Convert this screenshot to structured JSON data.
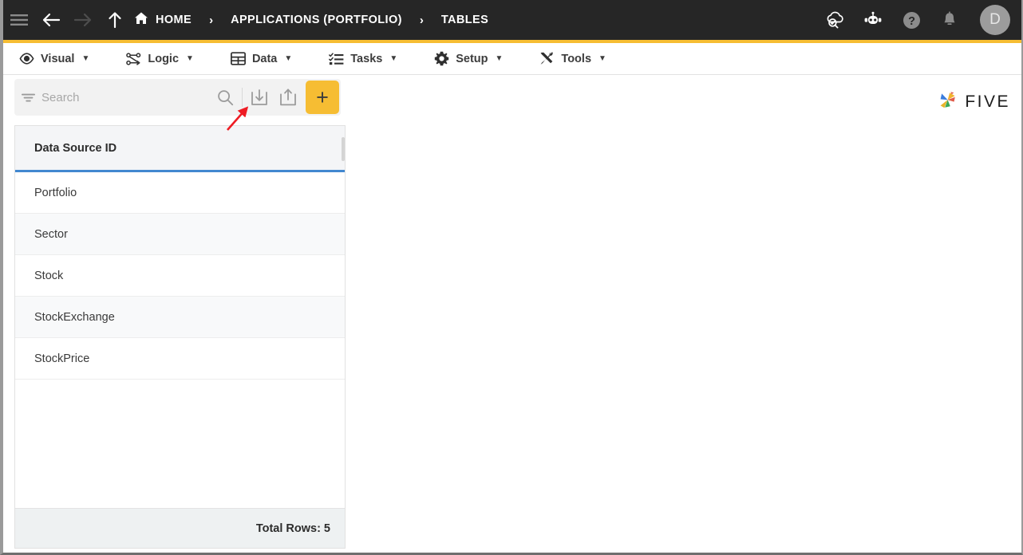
{
  "header": {
    "menu_icon": "hamburger-icon",
    "nav": [
      {
        "name": "back",
        "icon": "arrow-left-icon",
        "enabled": true
      },
      {
        "name": "forward",
        "icon": "arrow-right-icon",
        "enabled": false
      },
      {
        "name": "up",
        "icon": "arrow-up-icon",
        "enabled": true
      }
    ],
    "breadcrumbs": [
      {
        "label": "HOME",
        "icon": "home-icon"
      },
      {
        "label": "APPLICATIONS (PORTFOLIO)",
        "icon": ""
      },
      {
        "label": "TABLES",
        "icon": ""
      }
    ],
    "separator": "›",
    "actions": [
      {
        "name": "cloud-check-icon",
        "label": ""
      },
      {
        "name": "robot-icon",
        "label": ""
      },
      {
        "name": "help-icon",
        "label": ""
      },
      {
        "name": "bell-icon",
        "label": ""
      }
    ],
    "avatar_initial": "D",
    "accent_color": "#f6bd33",
    "bar_color": "#262626"
  },
  "menubar": {
    "items": [
      {
        "label": "Visual",
        "icon": "eye-icon",
        "caret": "▼"
      },
      {
        "label": "Logic",
        "icon": "logic-nodes-icon",
        "caret": "▼"
      },
      {
        "label": "Data",
        "icon": "grid-icon",
        "caret": "▼"
      },
      {
        "label": "Tasks",
        "icon": "checklist-icon",
        "caret": "▼"
      },
      {
        "label": "Setup",
        "icon": "gear-icon",
        "caret": "▼"
      },
      {
        "label": "Tools",
        "icon": "tools-icon",
        "caret": "▼"
      }
    ],
    "brand": "FIVE"
  },
  "toolbar": {
    "filter_icon": "filter-icon",
    "search_placeholder": "Search",
    "search_value": "",
    "search_icon": "search-icon",
    "import_icon": "import-icon",
    "export_icon": "export-icon",
    "add_label": "+"
  },
  "table": {
    "columns": [
      "Data Source ID"
    ],
    "rows": [
      {
        "data_source_id": "Portfolio"
      },
      {
        "data_source_id": "Sector"
      },
      {
        "data_source_id": "Stock"
      },
      {
        "data_source_id": "StockExchange"
      },
      {
        "data_source_id": "StockPrice"
      }
    ],
    "footer": "Total Rows: 5",
    "header_underline_color": "#4288d0"
  },
  "annotation": {
    "type": "arrow",
    "color": "#ee1c24",
    "points_to": "import-icon"
  }
}
